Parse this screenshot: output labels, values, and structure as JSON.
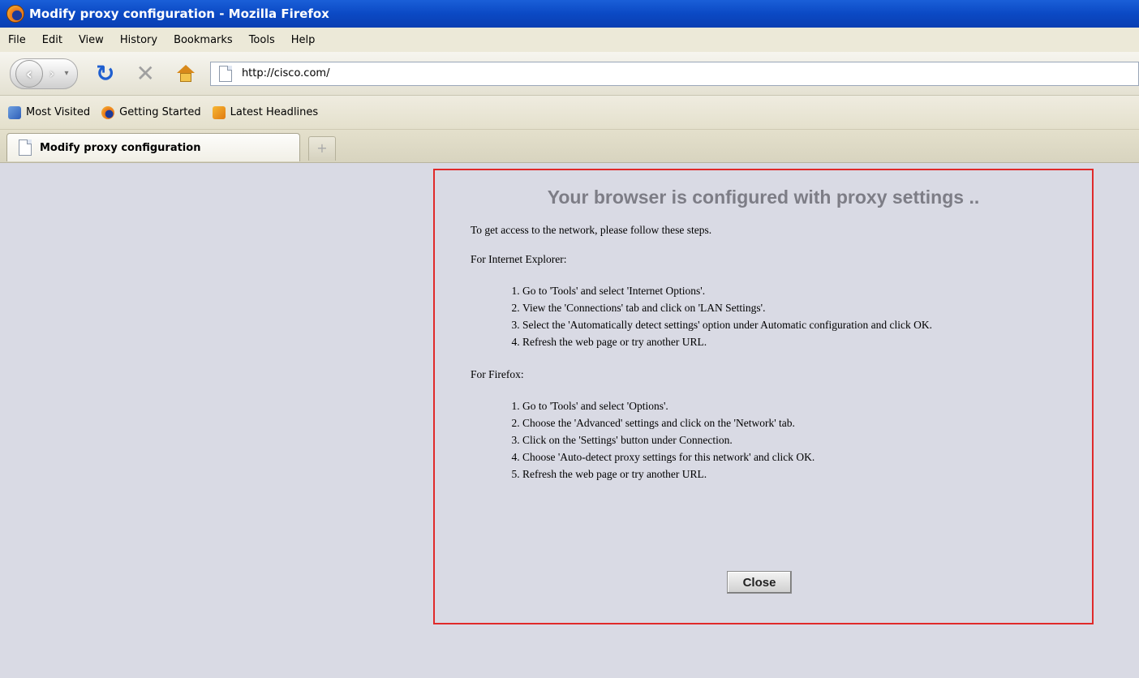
{
  "window": {
    "title": "Modify proxy configuration - Mozilla Firefox"
  },
  "menu": [
    "File",
    "Edit",
    "View",
    "History",
    "Bookmarks",
    "Tools",
    "Help"
  ],
  "address_bar": {
    "url": "http://cisco.com/"
  },
  "bookmarks": [
    "Most Visited",
    "Getting Started",
    "Latest Headlines"
  ],
  "tabs": [
    {
      "label": "Modify proxy configuration",
      "active": true
    }
  ],
  "new_tab_symbol": "+",
  "dialog": {
    "title": "Your browser is configured with proxy settings ..",
    "intro": "To get access to the network, please follow these steps.",
    "ie_heading": "For Internet Explorer:",
    "ie_steps": [
      "Go to 'Tools' and select 'Internet Options'.",
      "View the 'Connections' tab and click on 'LAN Settings'.",
      "Select the 'Automatically detect settings' option under Automatic configuration and click OK.",
      "Refresh the web page or try another URL."
    ],
    "ff_heading": "For Firefox:",
    "ff_steps": [
      "Go to 'Tools' and select 'Options'.",
      "Choose the 'Advanced' settings and click on the 'Network' tab.",
      "Click on the 'Settings' button under Connection.",
      "Choose 'Auto-detect proxy settings for this network' and click OK.",
      "Refresh the web page or try another URL."
    ],
    "close_label": "Close"
  },
  "colors": {
    "title_bar": "#0b49c4",
    "dialog_border": "#e02a2a",
    "page_bg": "#d9dae4"
  }
}
